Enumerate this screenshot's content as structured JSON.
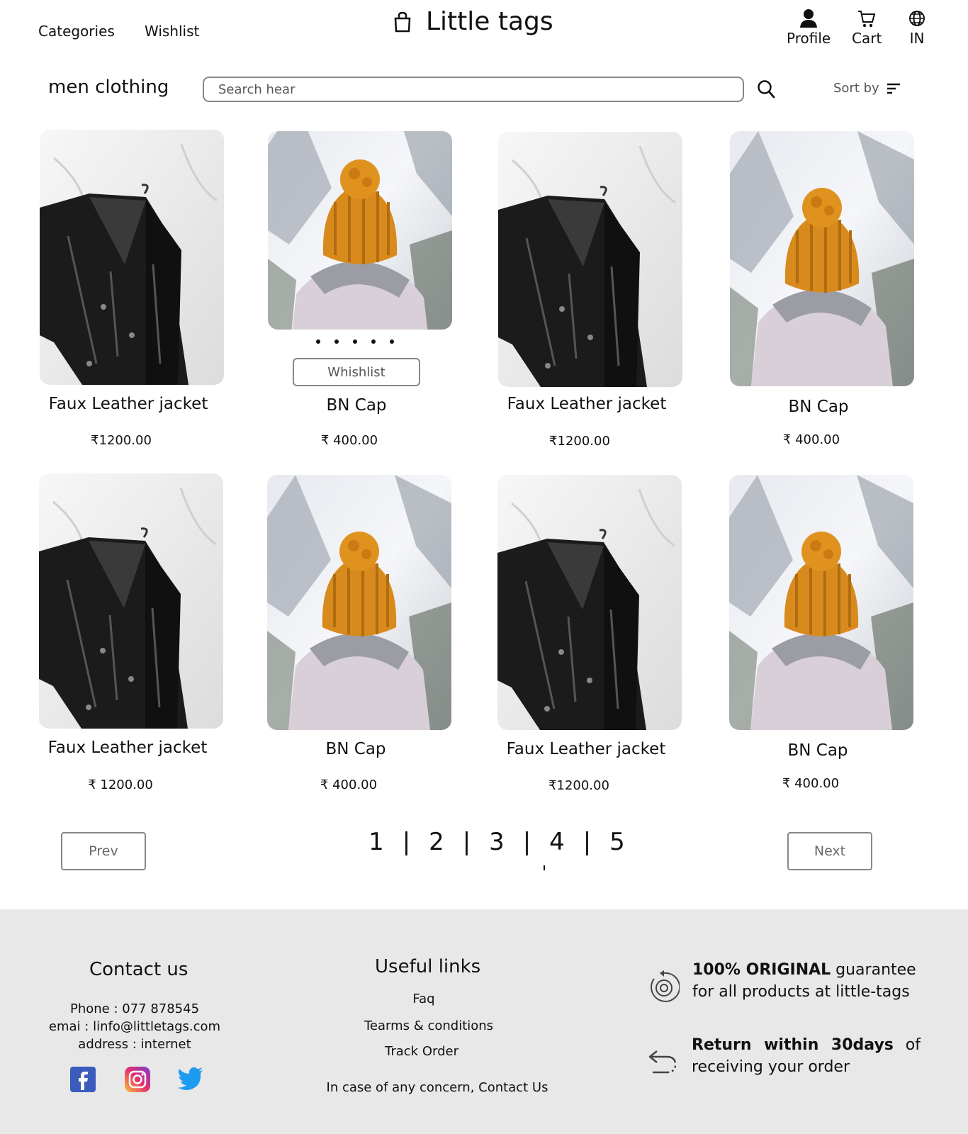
{
  "header": {
    "categories_label": "Categories",
    "wishlist_label": "Wishlist",
    "brand_name": "Little tags",
    "profile_label": "Profile",
    "cart_label": "Cart",
    "region_label": "IN"
  },
  "toolbar": {
    "section_title": "men clothing",
    "search_placeholder": "Search hear",
    "sort_label": "Sort by"
  },
  "products": [
    {
      "name": "Faux Leather jacket",
      "price": "₹1200.00",
      "image": "leather-jacket"
    },
    {
      "name": "BN Cap",
      "price": "₹ 400.00",
      "image": "orange-beanie",
      "wishlist_label": "Whishlist"
    },
    {
      "name": "Faux Leather jacket",
      "price": "₹1200.00",
      "image": "leather-jacket"
    },
    {
      "name": "BN Cap",
      "price": "₹ 400.00",
      "image": "orange-beanie"
    },
    {
      "name": "Faux Leather jacket",
      "price": "₹ 1200.00",
      "image": "leather-jacket"
    },
    {
      "name": "BN Cap",
      "price": "₹ 400.00",
      "image": "orange-beanie"
    },
    {
      "name": "Faux Leather jacket",
      "price": "₹1200.00",
      "image": "leather-jacket"
    },
    {
      "name": "BN Cap",
      "price": "₹ 400.00",
      "image": "orange-beanie"
    }
  ],
  "pagination": {
    "prev_label": "Prev",
    "next_label": "Next",
    "pages": [
      "1",
      "2",
      "3",
      "4",
      "5"
    ],
    "separator": "|",
    "current_page": "4"
  },
  "footer": {
    "contact_heading": "Contact us",
    "phone": "Phone  : 077 878545",
    "email": "emai : linfo@littletags.com",
    "address": "address : internet",
    "links_heading": "Useful links",
    "links": [
      "Faq",
      "Tearms & conditions",
      "Track Order"
    ],
    "concern_text": "In case of any concern, Contact Us",
    "original_bold": "100% ORIGINAL",
    "original_rest": " guarantee for all products at little-tags",
    "return_bold": "Return within 30days",
    "return_rest": " of receiving your order",
    "social_icons": [
      "facebook-icon",
      "instagram-icon",
      "twitter-icon"
    ]
  },
  "colors": {
    "footer_bg": "#e8e8e8",
    "beanie": "#d98a1c",
    "jacket": "#1a1a1a",
    "twitter": "#1d9bf0",
    "facebook": "#3b5bbd"
  }
}
